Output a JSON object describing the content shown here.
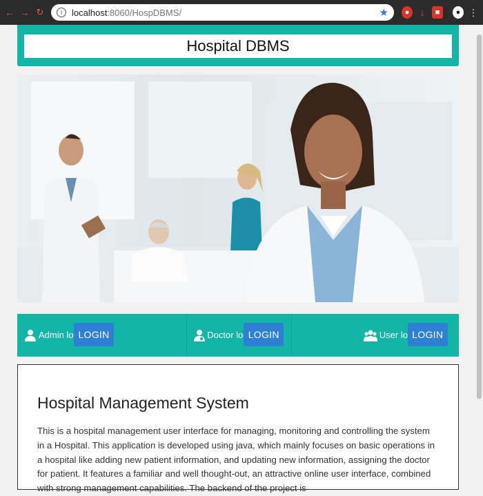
{
  "browser": {
    "url_host": "localhost",
    "url_rest": ":8060/HospDBMS/"
  },
  "header": {
    "title": "Hospital DBMS"
  },
  "logins": [
    {
      "label": "Admin login",
      "button": "LOGIN"
    },
    {
      "label": "Doctor login",
      "button": "LOGIN"
    },
    {
      "label": "User login",
      "button": "LOGIN"
    }
  ],
  "main": {
    "heading": "Hospital Management System",
    "body": "This is a hospital management user interface for managing, monitoring and controlling the system in a Hospital. This application is developed using java, which mainly focuses on basic operations in a hospital like adding new patient information, and updating new information, assigning the doctor for patient. It features a familiar and well thought-out, an attractive online user interface, combined with strong management capabilities. The backend of the project is"
  },
  "icons": {
    "back": "back-arrow-icon",
    "forward": "forward-arrow-icon",
    "reload": "reload-icon",
    "info": "info-icon",
    "star": "bookmark-star-icon",
    "admin": "user-icon",
    "doctor": "doctor-icon",
    "users": "users-group-icon"
  },
  "colors": {
    "teal": "#12b5a6",
    "button_blue": "#2f7fd4",
    "chrome_dark": "#2b2b2b"
  }
}
